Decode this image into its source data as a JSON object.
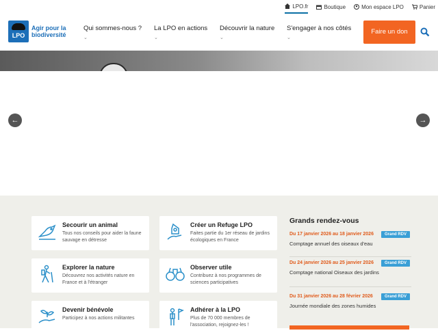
{
  "util": {
    "lpo": "LPO.fr",
    "boutique": "Boutique",
    "espace": "Mon espace LPO",
    "panier": "Panier"
  },
  "logo": {
    "mark": "LPO",
    "tagline": "Agir pour la biodiversité"
  },
  "nav": [
    {
      "label": "Qui sommes-nous ?"
    },
    {
      "label": "La LPO en actions"
    },
    {
      "label": "Découvrir la nature"
    },
    {
      "label": "S'engager à nos côtés"
    }
  ],
  "don": "Faire un don",
  "colors": {
    "brand": "#1d6fb8",
    "accent": "#f26522",
    "badge": "#3a9fd6",
    "section_bg": "#efefea"
  },
  "cards": [
    {
      "title": "Secourir un animal",
      "desc": "Tous nos conseils pour aider la faune sauvage en détresse",
      "icon": "bird-care-icon"
    },
    {
      "title": "Créer un Refuge LPO",
      "desc": "Faites partie du 1er réseau de jardins écologiques en France",
      "icon": "birdhouse-hand-icon"
    },
    {
      "title": "Explorer la nature",
      "desc": "Découvrez nos activités nature en France et à l'étranger",
      "icon": "hiker-icon"
    },
    {
      "title": "Observer utile",
      "desc": "Contribuez à nos programmes de sciences participatives",
      "icon": "binoculars-icon"
    },
    {
      "title": "Devenir bénévole",
      "desc": "Participez à nos actions militantes",
      "icon": "sprout-hand-icon"
    },
    {
      "title": "Adhérer à la LPO",
      "desc": "Plus de 70 000 membres de l'association, rejoignez-les !",
      "icon": "person-flag-icon"
    }
  ],
  "rdv": {
    "title": "Grands rendez-vous",
    "events": [
      {
        "date": "Du 17 janvier 2026 au 18 janvier 2026",
        "name": "Comptage annuel des oiseaux d'eau",
        "badge": "Grand RDV"
      },
      {
        "date": "Du 24 janvier 2026 au 25 janvier 2026",
        "name": "Comptage national Oiseaux des jardins",
        "badge": "Grand RDV"
      },
      {
        "date": "Du 31 janvier 2026 au 28 février 2026",
        "name": "Journée mondiale des zones humides",
        "badge": "Grand RDV"
      }
    ]
  }
}
